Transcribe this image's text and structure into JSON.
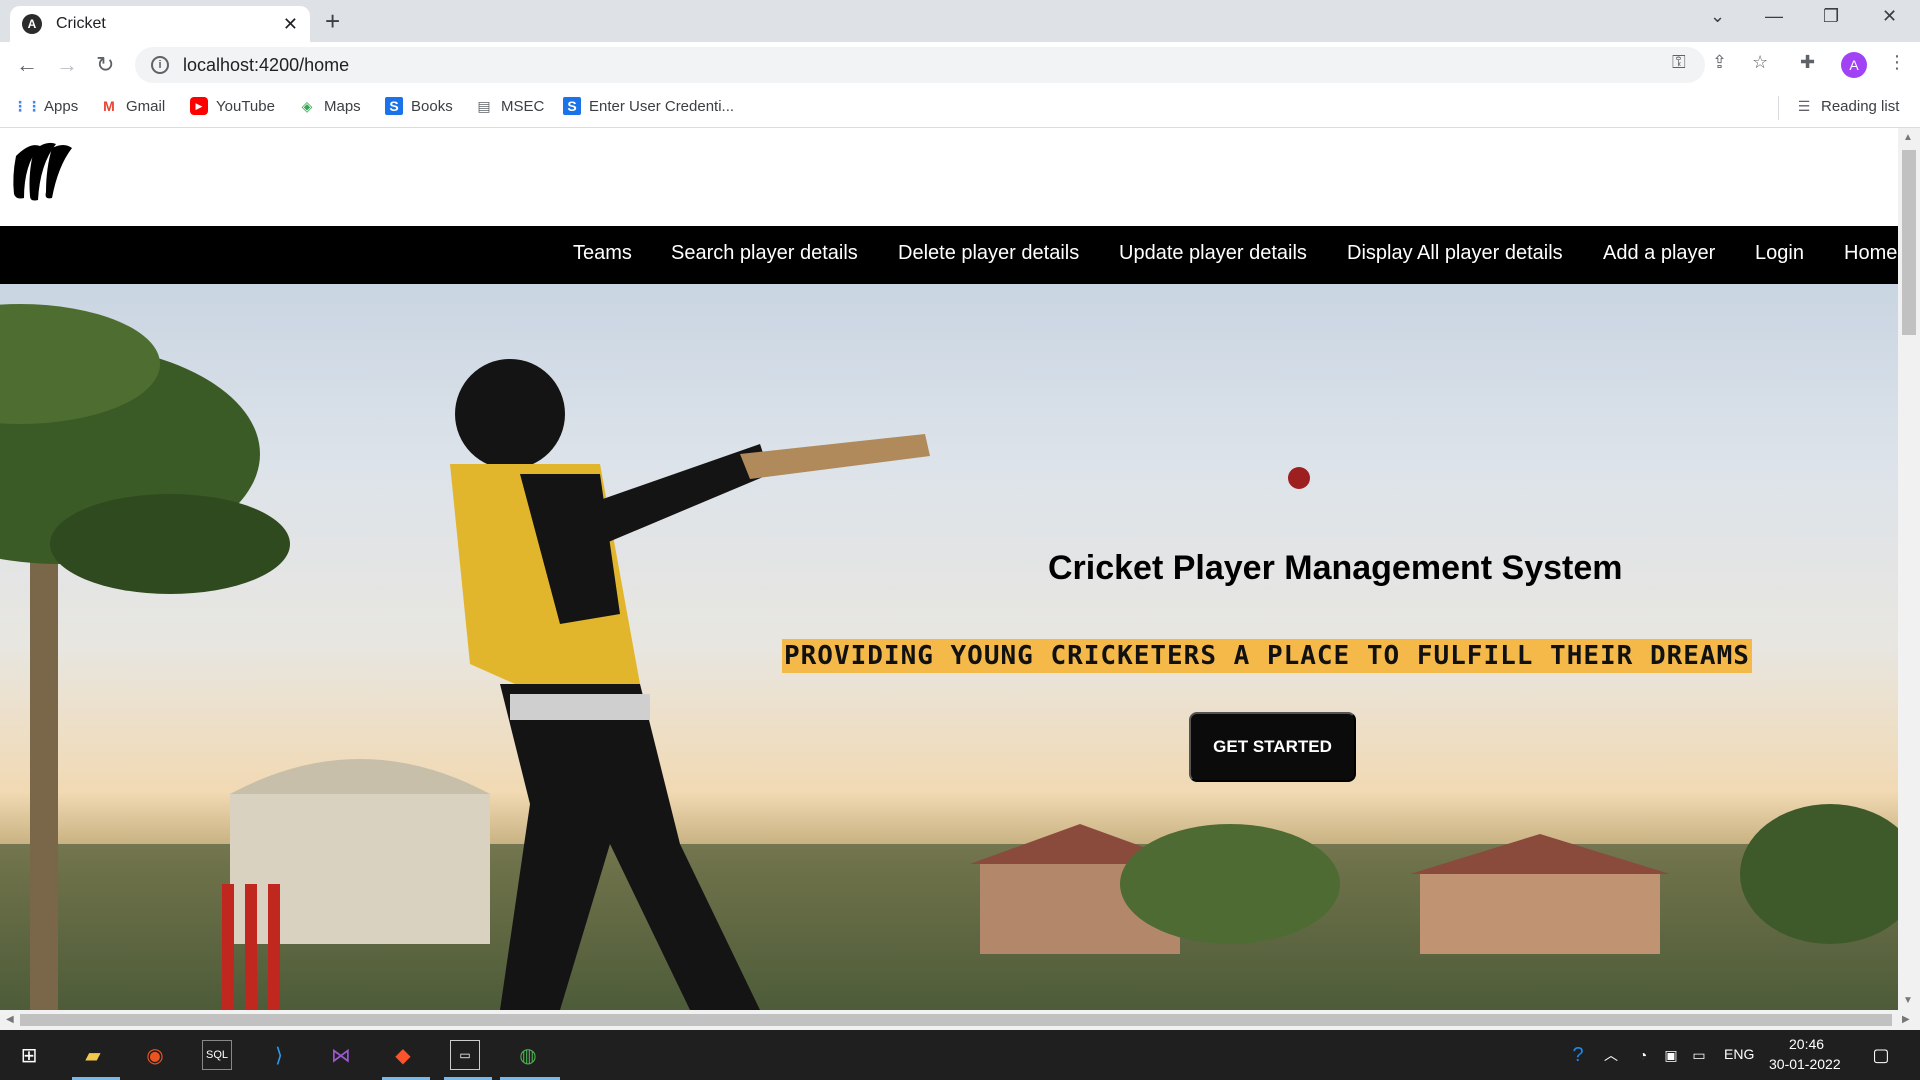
{
  "browser": {
    "tab_title": "Cricket",
    "url": "localhost:4200/home",
    "profile_initial": "A",
    "bookmarks": [
      "Apps",
      "Gmail",
      "YouTube",
      "Maps",
      "Books",
      "MSEC",
      "Enter User Credenti..."
    ],
    "reading_list": "Reading list"
  },
  "site": {
    "nav": [
      "Teams",
      "Search player details",
      "Delete player details",
      "Update player details",
      "Display All player details",
      "Add a player",
      "Login",
      "Home"
    ],
    "hero_title": "Cricket Player Management System",
    "hero_subtitle": "PROVIDING YOUNG CRICKETERS A PLACE TO FULFILL THEIR DREAMS",
    "cta_label": "GET STARTED"
  },
  "taskbar": {
    "lang": "ENG",
    "time": "20:46",
    "date": "30-01-2022"
  },
  "colors": {
    "accent_highlight": "#f5b94a",
    "navbar_bg": "#000000",
    "cta_bg": "#0b0b0b"
  }
}
